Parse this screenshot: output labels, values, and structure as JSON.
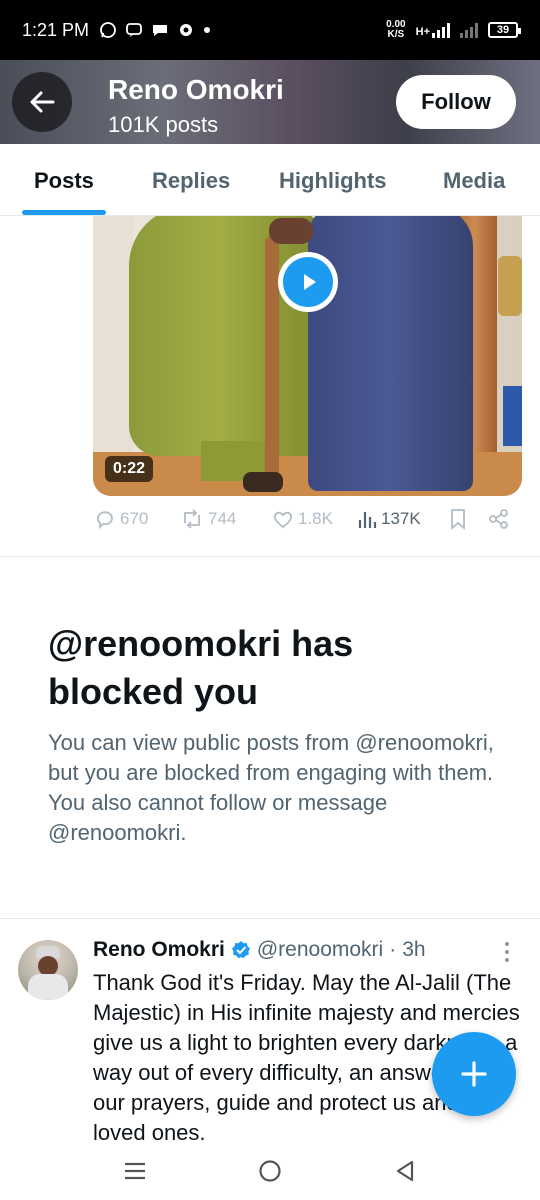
{
  "status_bar": {
    "time": "1:21 PM",
    "speed_value": "0.00",
    "speed_unit": "K/S",
    "network": "H+",
    "battery": "39"
  },
  "header": {
    "name": "Reno Omokri",
    "posts_count": "101K posts",
    "follow_label": "Follow"
  },
  "tabs": [
    {
      "label": "Posts",
      "active": true
    },
    {
      "label": "Replies",
      "active": false
    },
    {
      "label": "Highlights",
      "active": false
    },
    {
      "label": "Media",
      "active": false
    }
  ],
  "video": {
    "duration": "0:22"
  },
  "actions": {
    "replies": "670",
    "reposts": "744",
    "likes": "1.8K",
    "views": "137K"
  },
  "blocked": {
    "title": "@renoomokri has blocked you",
    "body": "You can view public posts from @renoomokri, but you are blocked from engaging with them. You also cannot follow or message @renoomokri."
  },
  "tweet": {
    "name": "Reno Omokri",
    "handle": "@renoomokri",
    "separator": "·",
    "time": "3h",
    "text": "Thank God it's Friday. May the Al-Jalil (The Majestic) in His infinite majesty and mercies give us a light to brighten every darkness, a way out of every difficulty, an answer to all our prayers, guide and protect us and our loved ones."
  },
  "colors": {
    "accent": "#1d9bf0",
    "text_primary": "#0f1419",
    "text_secondary": "#536471"
  },
  "icons": {
    "back": "arrow-left-icon",
    "play": "play-icon",
    "reply": "comment-icon",
    "repost": "repost-icon",
    "like": "heart-icon",
    "views": "bar-chart-icon",
    "bookmark": "bookmark-icon",
    "share": "share-icon",
    "verified": "verified-badge-icon",
    "compose": "plus-icon"
  }
}
